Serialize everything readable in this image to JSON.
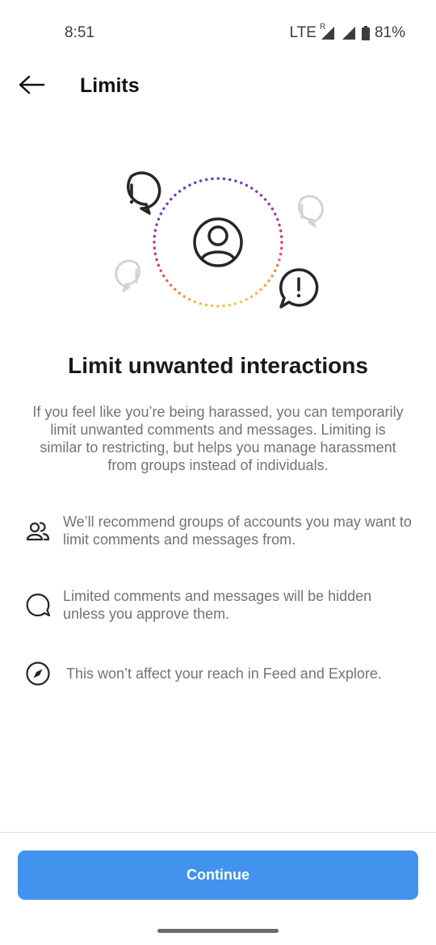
{
  "status_bar": {
    "time": "8:51",
    "network": "LTE",
    "roaming": "R",
    "battery": "81%"
  },
  "header": {
    "title": "Limits",
    "back_icon": "arrow-left-icon"
  },
  "main": {
    "headline": "Limit unwanted interactions",
    "description": "If you feel like you’re being harassed, you can temporarily limit unwanted comments and messages. Limiting is similar to restricting, but helps you manage harassment from groups instead of individuals.",
    "features": [
      {
        "icon": "people-icon",
        "text": "We’ll recommend groups of accounts you may want to limit comments and messages from."
      },
      {
        "icon": "speech-bubble-icon",
        "text": "Limited comments and messages will be hidden unless you approve them."
      },
      {
        "icon": "compass-icon",
        "text": "This won’t affect your reach in Feed and Explore."
      }
    ]
  },
  "footer": {
    "continue_label": "Continue"
  },
  "colors": {
    "accent": "#4293ee",
    "text_primary": "#262626",
    "text_secondary": "#737373",
    "ring_gradient": [
      "#8a3ab9",
      "#c13584",
      "#e1306c",
      "#fd1d1d",
      "#f77737",
      "#fcaf45"
    ]
  }
}
